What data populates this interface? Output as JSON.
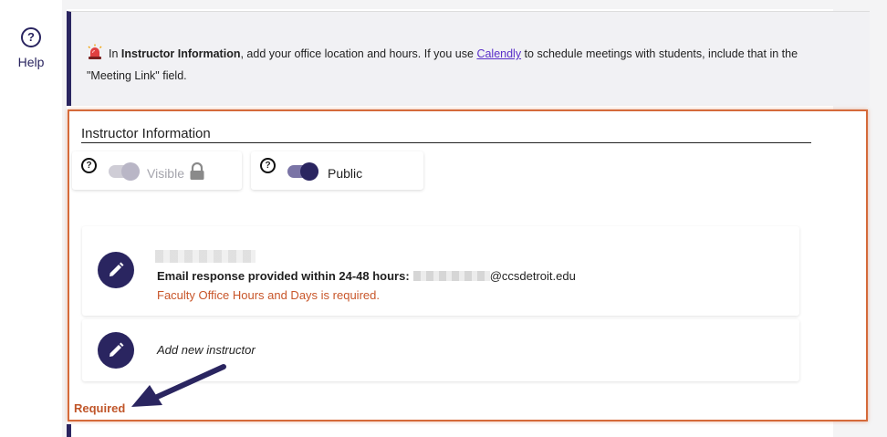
{
  "help": {
    "label": "Help",
    "icon": "help-circle-icon"
  },
  "banner": {
    "icon": "alarm-light-icon",
    "prefix": "In ",
    "bold": "Instructor Information",
    "middle": ", add your office location and hours. If you use ",
    "link": "Calendly",
    "suffix": " to schedule meetings with students, include that in the \"Meeting Link\" field."
  },
  "section": {
    "title": "Instructor Information",
    "toggles": [
      {
        "label": "Visible",
        "state": "disabled",
        "icon": "lock-icon"
      },
      {
        "label": "Public",
        "state": "on"
      }
    ],
    "instructor": {
      "email_label": "Email response provided within 24-48 hours:",
      "email_domain": "@ccsdetroit.edu",
      "error": "Faculty Office Hours and Days is required."
    },
    "add_label": "Add new instructor",
    "required": "Required"
  },
  "colors": {
    "accent": "#2a2560",
    "error": "#c8562a",
    "highlight_border": "#d56a3a",
    "link": "#5a2fc9"
  }
}
